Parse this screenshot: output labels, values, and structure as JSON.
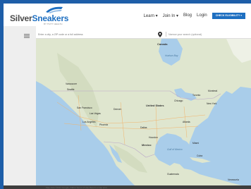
{
  "brand": {
    "name_part1": "Silver",
    "name_part2": "Sneakers",
    "tagline": "BY TIVITY HEALTH"
  },
  "nav": {
    "learn": "Learn",
    "join_in": "Join In",
    "blog": "Blog",
    "login": "Login",
    "cta": "CHECK ELIGIBILITY"
  },
  "search": {
    "location_placeholder": "Enter a city, a ZIP code or a full address",
    "keyword_placeholder": "Narrow your search (optional)"
  },
  "map": {
    "labels": {
      "canada": "Canada",
      "united_states": "United States",
      "mexico": "Mexico",
      "gulf": "Gulf of Mexico",
      "cuba": "Cuba",
      "vancouver": "Vancouver",
      "seattle": "Seattle",
      "san_francisco": "San Francisco",
      "las_vegas": "Las Vegas",
      "los_angeles": "Los Angeles",
      "phoenix": "Phoenix",
      "denver": "Denver",
      "dallas": "Dallas",
      "houston": "Houston",
      "chicago": "Chicago",
      "toronto": "Toronto",
      "montreal": "Montreal",
      "new_york": "New York",
      "atlanta": "Atlanta",
      "miami": "Miami",
      "hudson_bay": "Hudson Bay",
      "venezuela": "Venezuela",
      "guatemala": "Guatemala"
    }
  },
  "colors": {
    "brand_blue": "#1e6fc1",
    "outer_border": "#1e5ea8",
    "water": "#a9cdea",
    "land": "#dfe6cf",
    "footer": "#3d3d3d"
  },
  "footer": {
    "text": "Map data ©2017 Google, INEGI  Terms of Use  Report a map error"
  }
}
